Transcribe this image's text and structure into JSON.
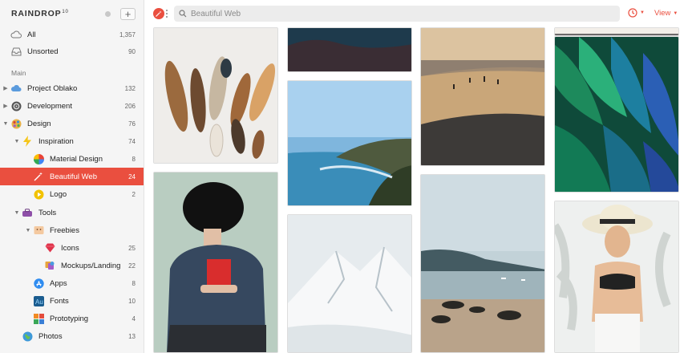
{
  "brand": {
    "name": "RAINDROP",
    "version": "10"
  },
  "sidebar": {
    "all": {
      "label": "All",
      "count": "1,357"
    },
    "unsorted": {
      "label": "Unsorted",
      "count": "90"
    },
    "section_main": "Main",
    "items": [
      {
        "label": "Project Oblako",
        "count": "132",
        "icon": "cloud-icon"
      },
      {
        "label": "Development",
        "count": "206",
        "icon": "gear-icon"
      },
      {
        "label": "Design",
        "count": "76",
        "icon": "palette-icon"
      },
      {
        "label": "Inspiration",
        "count": "74",
        "icon": "lightning-icon"
      },
      {
        "label": "Material Design",
        "count": "8",
        "icon": "pinwheel-icon"
      },
      {
        "label": "Beautiful Web",
        "count": "24",
        "icon": "magic-wand-icon"
      },
      {
        "label": "Logo",
        "count": "2",
        "icon": "play-circle-icon"
      },
      {
        "label": "Tools",
        "count": "",
        "icon": "toolbox-icon"
      },
      {
        "label": "Freebies",
        "count": "",
        "icon": "gift-box-icon"
      },
      {
        "label": "Icons",
        "count": "25",
        "icon": "gem-icon"
      },
      {
        "label": "Mockups/Landing",
        "count": "22",
        "icon": "palette-cards-icon"
      },
      {
        "label": "Apps",
        "count": "8",
        "icon": "app-store-icon"
      },
      {
        "label": "Fonts",
        "count": "10",
        "icon": "font-icon"
      },
      {
        "label": "Prototyping",
        "count": "4",
        "icon": "grid-app-icon"
      },
      {
        "label": "Photos",
        "count": "13",
        "icon": "globe-icon"
      }
    ]
  },
  "toolbar": {
    "search_placeholder": "Beautiful Web",
    "view_label": "View",
    "accent": "#ea4f3f"
  }
}
